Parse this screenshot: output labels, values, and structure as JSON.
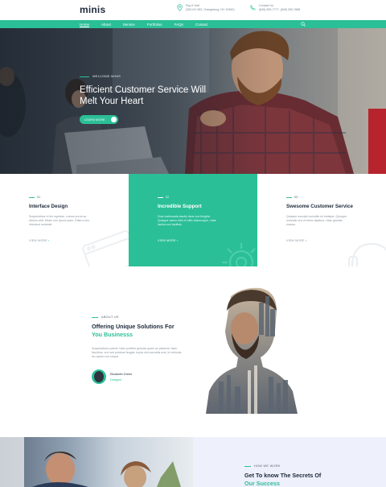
{
  "brand": {
    "logo": "minis",
    "accent": "#2bbf97",
    "dark": "#1d2a3a",
    "panel_bg": "#eef0fb"
  },
  "header": {
    "contact_location": {
      "icon": "map-pin-icon",
      "line1": "Pay A Visit",
      "line2": "(352-NY-363, Orangeburg, NY 10962)"
    },
    "contact_phone": {
      "icon": "phone-icon",
      "line1": "Contact Us",
      "line2": "(845) 359-7777, (845) 359-7888"
    }
  },
  "nav": {
    "items": [
      "Home",
      "About",
      "Service",
      "Portfolios",
      "FAQs",
      "Contact"
    ],
    "search_icon": "search-icon"
  },
  "hero": {
    "eyebrow": "WELCOME MINIS",
    "title": "Efficient Customer Service Will Melt Your Heart",
    "button": "LEARN MORE"
  },
  "features": [
    {
      "num": "01",
      "title": "Interface Design",
      "text": "Suspendisse et leo egestas, cursus purus ac, dictum velit. Etiam non ipsum justo. Etiam a leo interdum molestie.",
      "more": "VIEW MORE",
      "icon": "browser-window-icon"
    },
    {
      "num": "02",
      "title": "Incredible Support",
      "text": "Duis malesuada iaculis risus non fringilla. Quisque varius nibh et nibh ullamcorper, vitae lacinia orci facilisis.",
      "more": "VIEW MORE",
      "icon": "gear-icon"
    },
    {
      "num": "03",
      "title": "Swesome Customer Service",
      "text": "Quisque suscipit convallis mi tristique. Quisque molestie orci et tortor dapibus, vitae gravida massa.",
      "more": "VIEW MORE",
      "icon": "headset-icon"
    }
  ],
  "about": {
    "eyebrow": "ABOUT US",
    "title_line1": "Offering Unique Solutions For",
    "title_line2": "You Businesss",
    "text": "Suspendisse potenti. Nam porttitor gravida quam ac placerat. Nam faucibus, orci sed pulvinar feugiat, turpis nisl convallis erat, id vehicula leo ipsum non neque.",
    "author_name": "Elizabeth Green",
    "author_role": "Designer"
  },
  "how": {
    "eyebrow": "HOW WE WORK",
    "title_line1": "Get To know The Secrets Of",
    "title_line2": "Our Success"
  }
}
